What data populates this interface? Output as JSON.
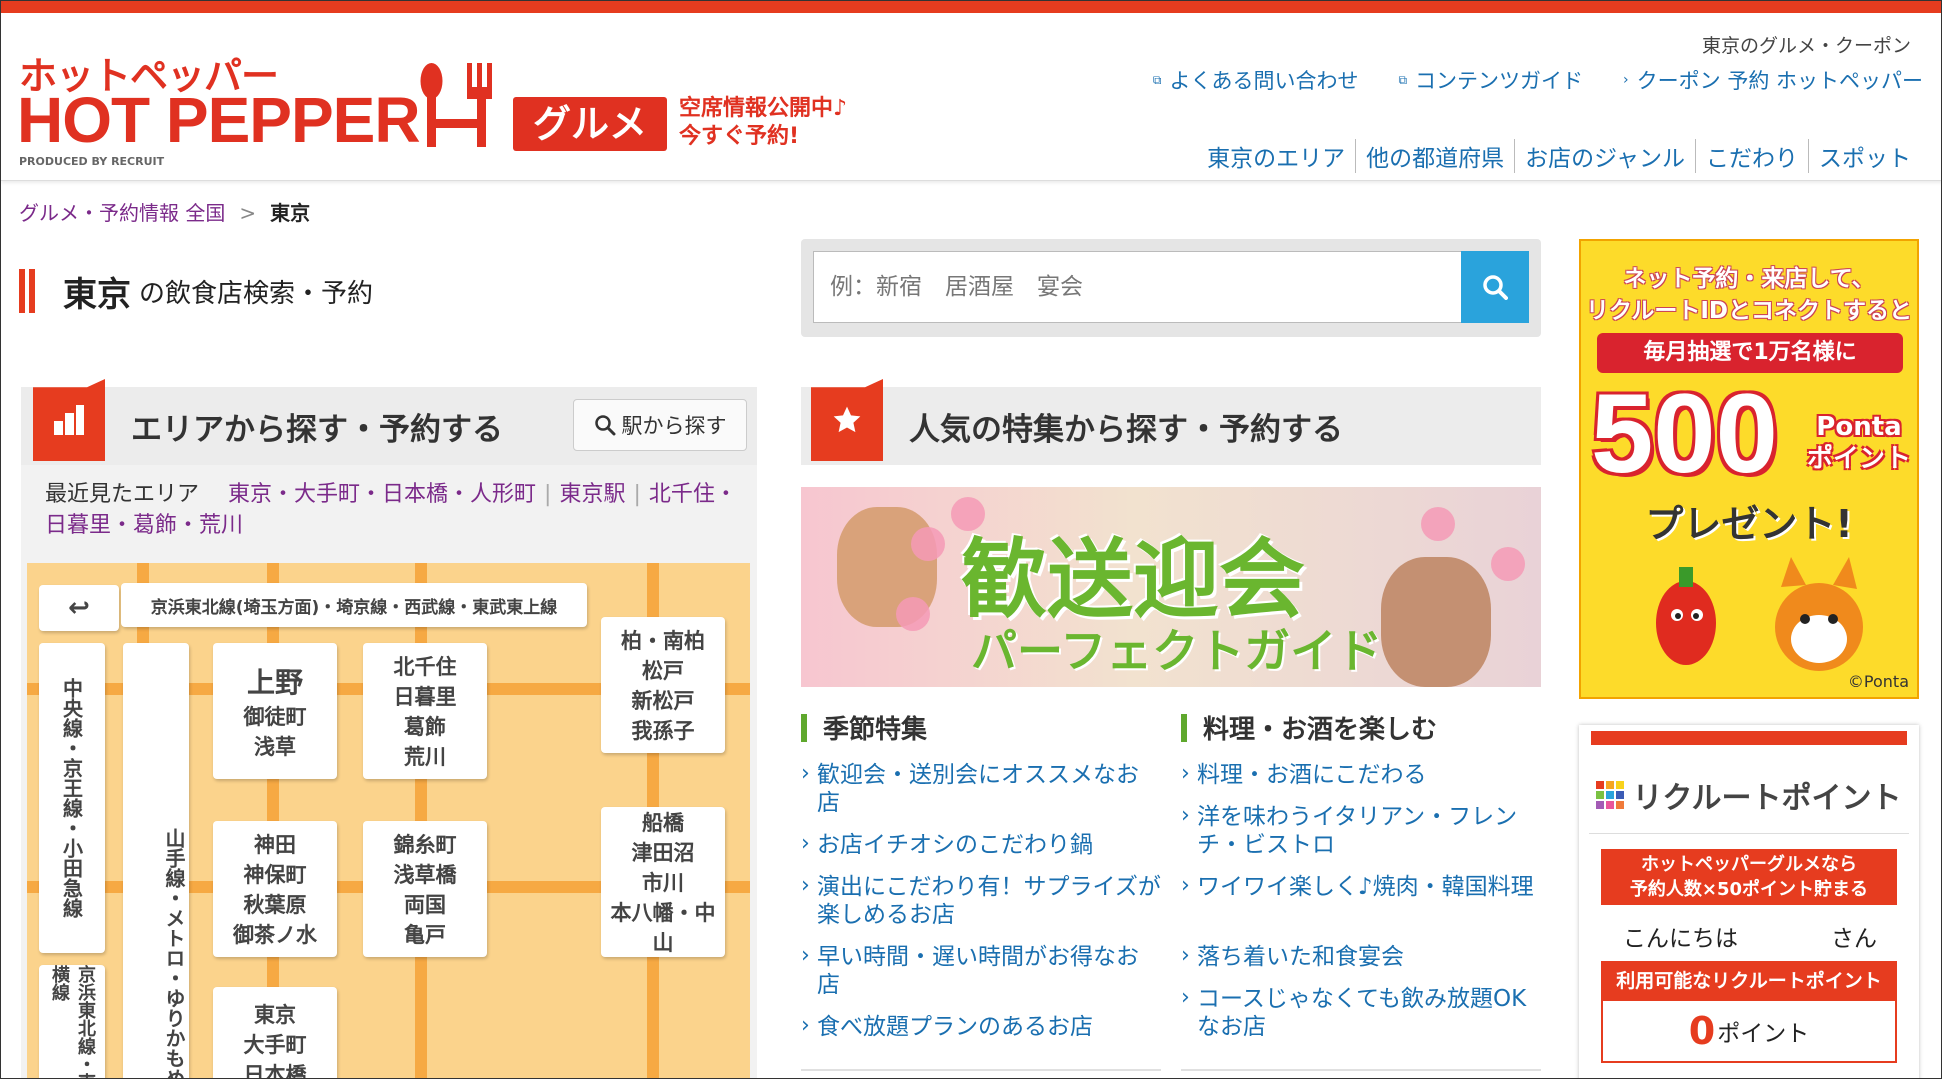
{
  "header": {
    "logo_kana": "ホットペッパー",
    "logo_main": "HOT PEPPER",
    "logo_produced": "PRODUCED BY RECRUIT",
    "logo_gourmet": "グルメ",
    "logo_tagline_1": "空席情報公開中♪",
    "logo_tagline_2": "今すぐ予約!",
    "util_text": "東京のグルメ・クーポン",
    "links": [
      {
        "label": "よくある問い合わせ"
      },
      {
        "label": "コンテンツガイド"
      },
      {
        "label": "クーポン 予約 ホットペッパー"
      }
    ],
    "nav": [
      {
        "label": "東京のエリア"
      },
      {
        "label": "他の都道府県"
      },
      {
        "label": "お店のジャンル"
      },
      {
        "label": "こだわり"
      },
      {
        "label": "スポット"
      }
    ]
  },
  "breadcrumb": {
    "home": "グルメ・予約情報 全国",
    "sep": ">",
    "current": "東京"
  },
  "page_title": {
    "city": "東京",
    "rest": "の飲食店検索・予約"
  },
  "search": {
    "placeholder": "例：新宿　居酒屋　宴会",
    "icon": "search-icon"
  },
  "area_section": {
    "title": "エリアから探す・予約する",
    "station_button": "駅から探す",
    "recent_label": "最近見たエリア",
    "recent_links": [
      {
        "label": "東京・大手町・日本橋・人形町"
      },
      {
        "label": "東京駅"
      },
      {
        "label": "北千住・日暮里・葛飾・荒川"
      }
    ],
    "map": {
      "line_top": "京浜東北線(埼玉方面)・埼京線・西武線・東武東上線",
      "line_left": "中央線・京王線・小田急線",
      "line_yamanote": "山手線・メトロ・ゆりかもめ",
      "line_bottom_left": "京浜東北線・東横線",
      "tiles": [
        {
          "lines": [
            "上野",
            "御徒町",
            "浅草"
          ]
        },
        {
          "lines": [
            "北千住",
            "日暮里",
            "葛飾",
            "荒川"
          ]
        },
        {
          "lines": [
            "柏・南柏",
            "松戸",
            "新松戸",
            "我孫子"
          ]
        },
        {
          "lines": [
            "神田",
            "神保町",
            "秋葉原",
            "御茶ノ水"
          ]
        },
        {
          "lines": [
            "錦糸町",
            "浅草橋",
            "両国",
            "亀戸"
          ]
        },
        {
          "lines": [
            "船橋",
            "津田沼",
            "市川",
            "本八幡・中山"
          ]
        },
        {
          "lines": [
            "東京",
            "大手町",
            "日本橋"
          ]
        }
      ]
    }
  },
  "feature_section": {
    "title": "人気の特集から探す・予約する",
    "banner_title": "歓送迎会",
    "banner_sub": "パーフェクトガイド",
    "col1_title": "季節特集",
    "col1_links": [
      {
        "label": "歓迎会・送別会にオススメなお店"
      },
      {
        "label": "お店イチオシのこだわり鍋"
      },
      {
        "label": "演出にこだわり有！サプライズが楽しめるお店"
      },
      {
        "label": "早い時間・遅い時間がお得なお店"
      },
      {
        "label": "食べ放題プランのあるお店"
      }
    ],
    "col2_title": "料理・お酒を楽しむ",
    "col2_links": [
      {
        "label": "料理・お酒にこだわる"
      },
      {
        "label": "洋を味わうイタリアン・フレンチ・ビストロ"
      },
      {
        "label": "ワイワイ楽しく♪焼肉・韓国料理"
      },
      {
        "label": "落ち着いた和食宴会"
      },
      {
        "label": "コースじゃなくても飲み放題OKなお店"
      }
    ]
  },
  "ad": {
    "line1": "ネット予約・来店して、",
    "line2": "リクルートIDとコネクトすると",
    "band": "毎月抽選で1万名様に",
    "amount": "500",
    "ponta_1": "Ponta",
    "ponta_2": "ポイント",
    "present": "プレゼント!",
    "copyright": "©Ponta"
  },
  "recruit_point": {
    "logo": "リクルートポイント",
    "promo_1": "ホットペッパーグルメなら",
    "promo_2": "予約人数×50ポイント貯まる",
    "hello": "こんにちは",
    "san": "さん",
    "available_label": "利用可能なリクルートポイント",
    "points": "0",
    "unit": "ポイント"
  },
  "colors": {
    "brand_red": "#e63c1f",
    "link_blue": "#1a6fb0",
    "visited_purple": "#7b2a8a",
    "search_blue": "#2aa3dc",
    "accent_green": "#5fa82d",
    "map_yellow": "#fbd38c"
  }
}
